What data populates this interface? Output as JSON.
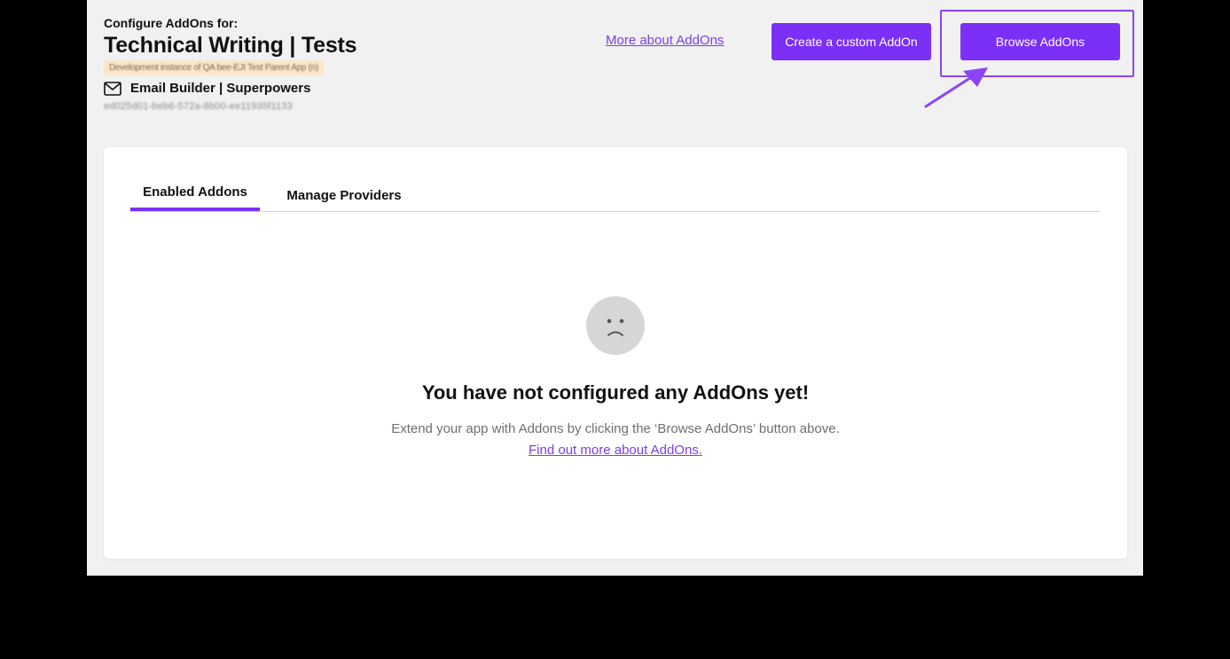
{
  "header": {
    "configure_label": "Configure AddOns for:",
    "app_title": "Technical Writing | Tests",
    "instance_tag": "Development instance of QA bee-EJI Test Parent App (n)",
    "builder_name": "Email Builder | Superpowers",
    "uuid": "ed025d01-beb6-572a-8b00-ee11935f1133"
  },
  "actions": {
    "more_link": "More about AddOns",
    "create_button": "Create a custom AddOn",
    "browse_button": "Browse AddOns"
  },
  "tabs": [
    {
      "label": "Enabled Addons",
      "active": true
    },
    {
      "label": "Manage Providers",
      "active": false
    }
  ],
  "empty_state": {
    "title": "You have not configured any AddOns yet!",
    "description_prefix": "Extend your app with Addons by clicking the ‘Browse AddOns’ button above.",
    "link": "Find out more about AddOns."
  },
  "icons": {
    "mail": "envelope-icon",
    "empty": "sad-face-icon",
    "annotation": "arrow-annotation"
  },
  "colors": {
    "accent": "#7b2ff7",
    "link": "#7b3fe4",
    "background": "#f1f1f1",
    "outer": "#000000"
  }
}
